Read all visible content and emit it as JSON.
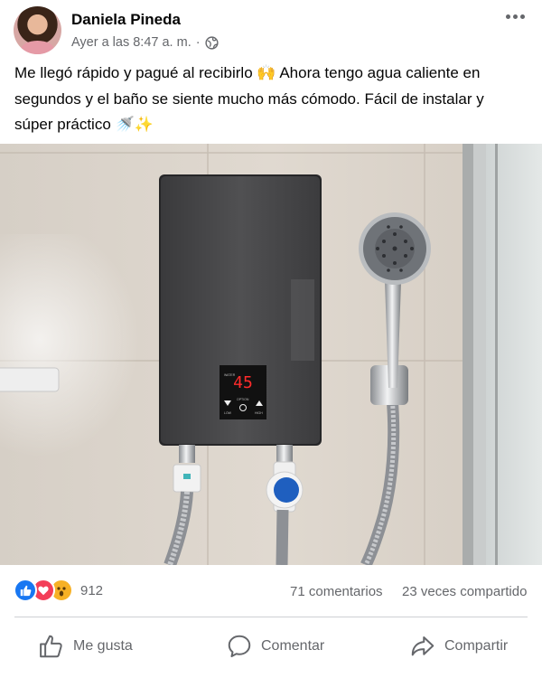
{
  "post": {
    "author": "Daniela Pineda",
    "timestamp": "Ayer a las 8:47 a. m.",
    "separator": "·",
    "privacy_icon": "globe-icon",
    "text": "Me llegó rápido y pagué al recibirlo 🙌 Ahora tengo agua caliente en segundos y el baño se siente mucho más cómodo. Fácil de instalar y súper práctico 🚿✨",
    "photo": {
      "display_value": "45",
      "panel_labels": {
        "top_left": "WATER",
        "option": "OPTION",
        "low": "LOW",
        "high": "HIGH"
      }
    }
  },
  "stats": {
    "reaction_icons": [
      "like-icon",
      "love-icon",
      "wow-icon"
    ],
    "reaction_count": "912",
    "comments": "71 comentarios",
    "shares": "23 veces compartido"
  },
  "actions": {
    "like": "Me gusta",
    "comment": "Comentar",
    "share": "Compartir"
  },
  "colors": {
    "like_blue": "#1877f2",
    "love_red": "#f33e58",
    "wow_yellow": "#f7b125",
    "secondary_text": "#65676b",
    "display_red": "#ff2b2b"
  }
}
